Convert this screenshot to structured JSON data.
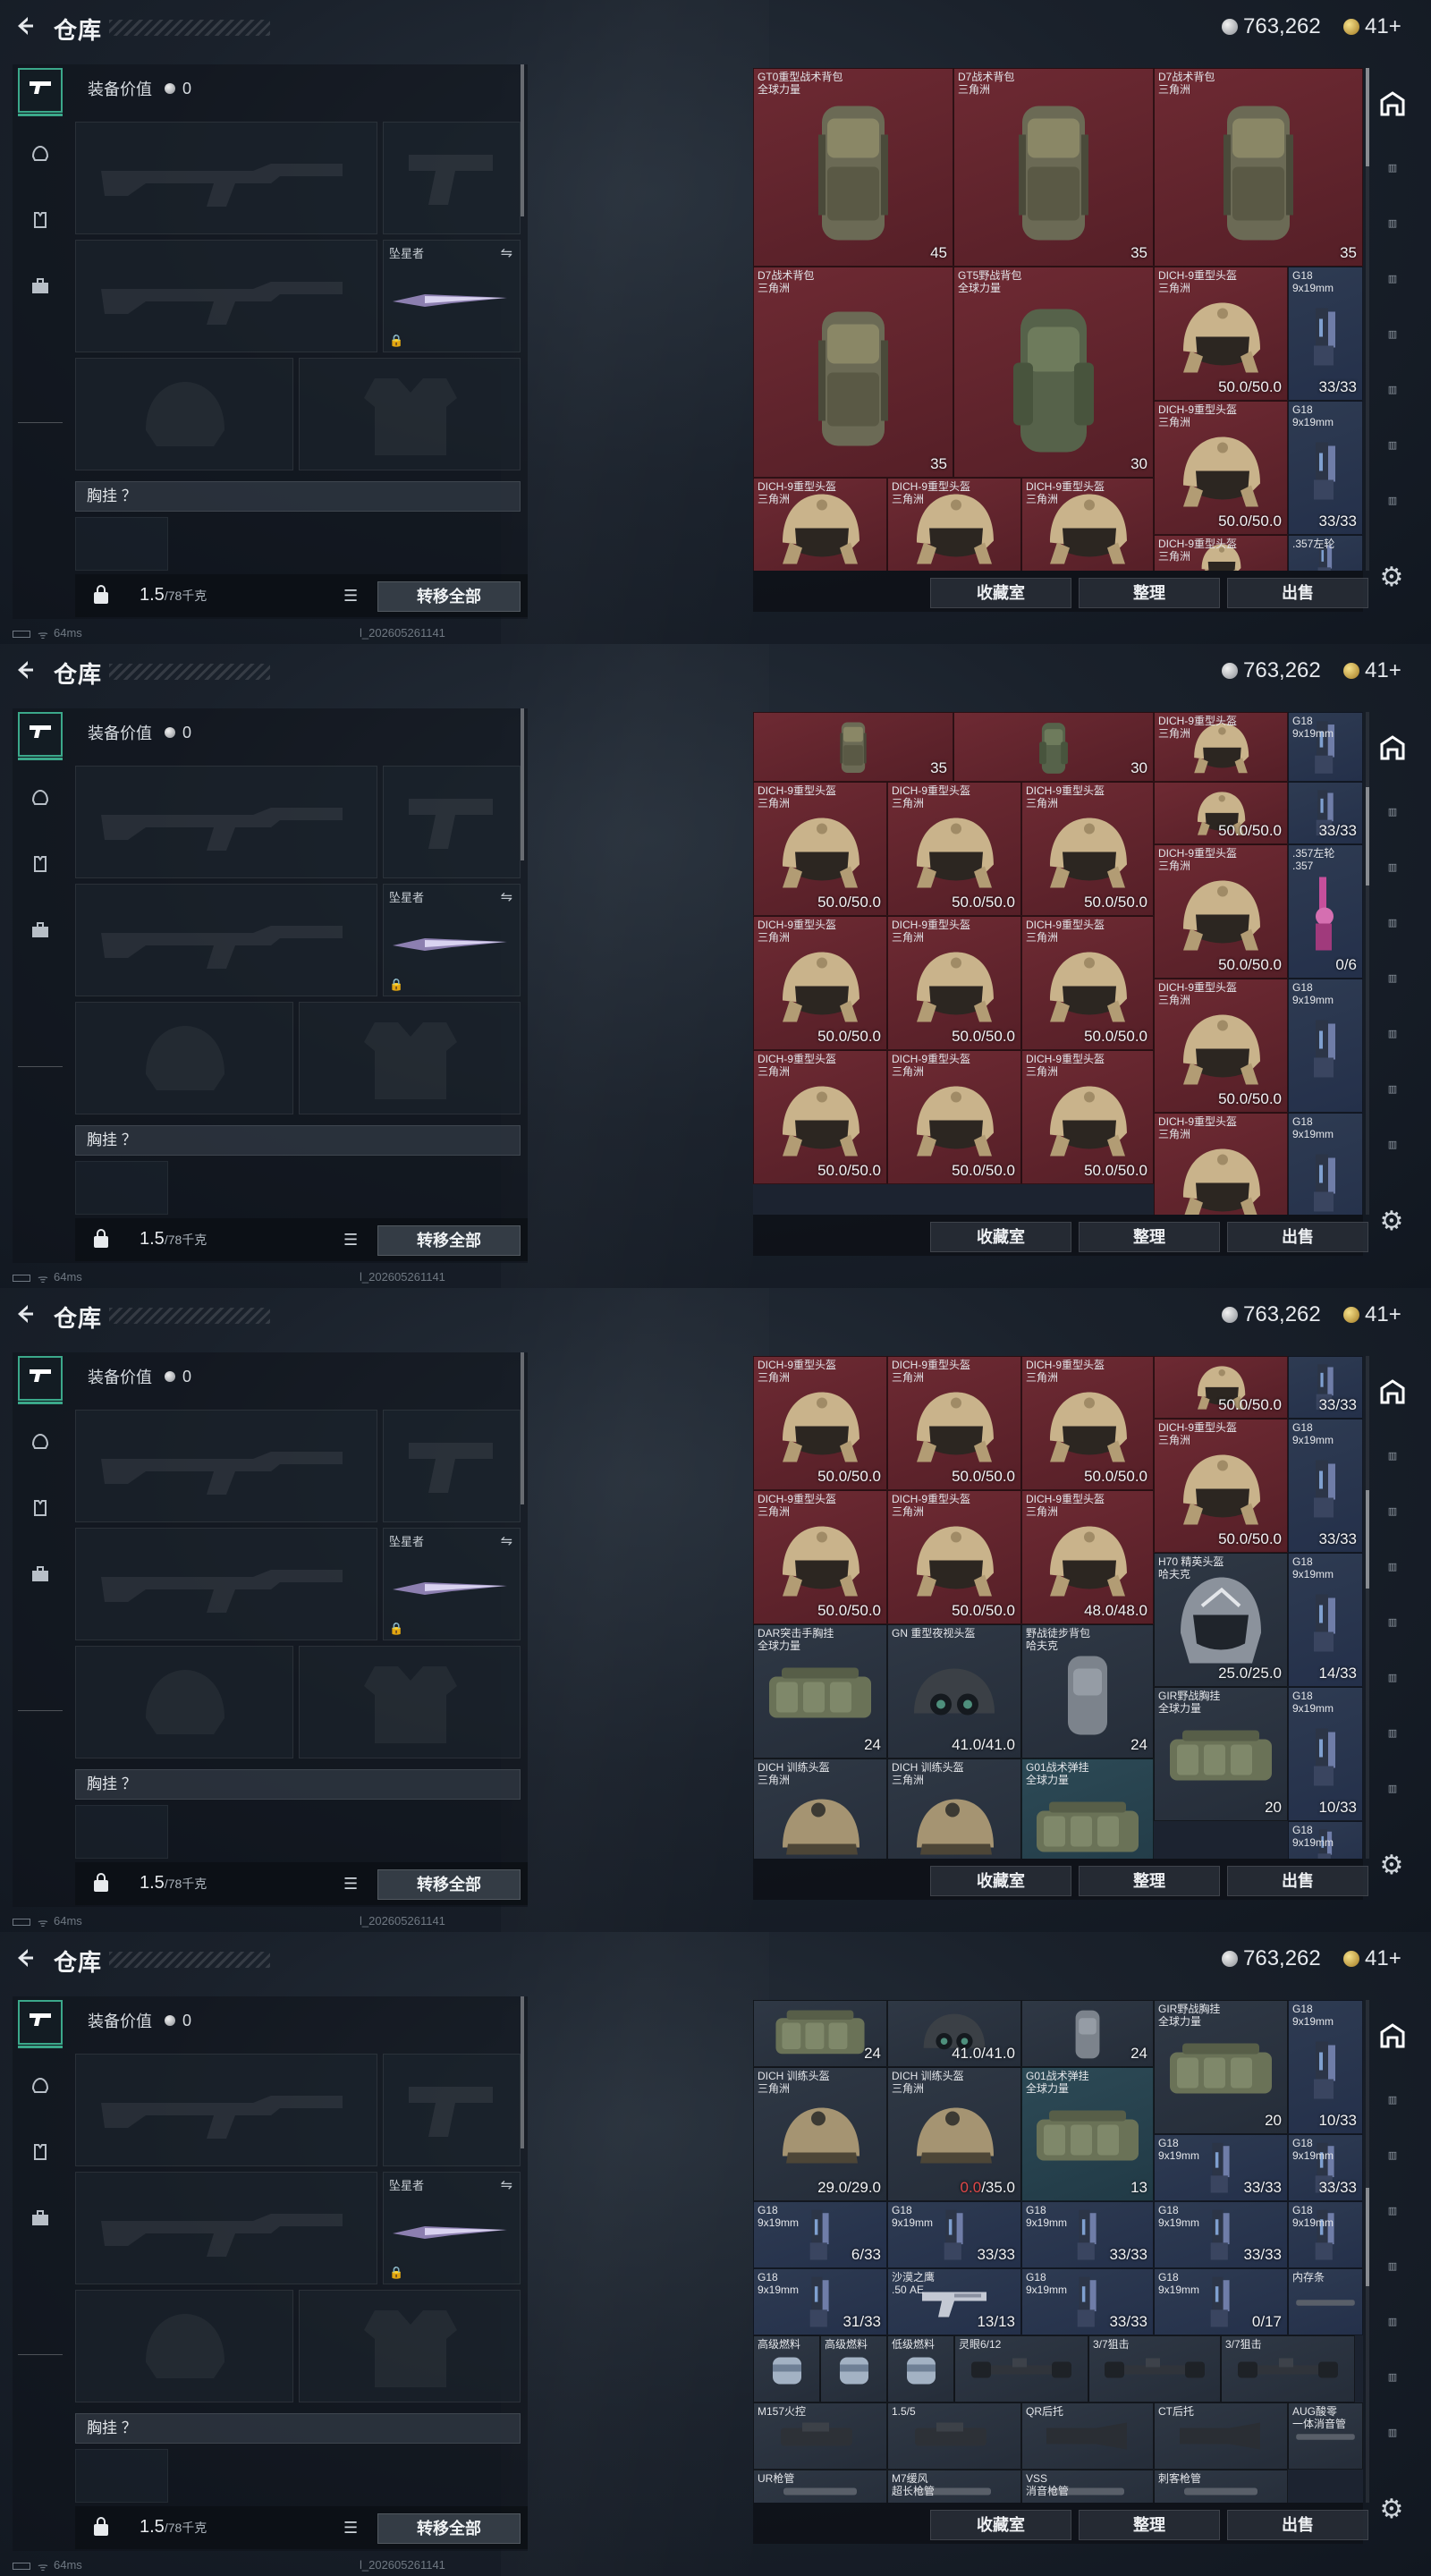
{
  "header": {
    "title": "仓库",
    "silver": "763,262",
    "gold": "41+"
  },
  "left": {
    "equip_value_label": "装备价值",
    "equip_value": "0",
    "melee_name": "坠星者",
    "chest_label": "胸挂 ？",
    "weight": "1.5",
    "weight_max": "/78千克",
    "transfer_all": "转移全部",
    "tabs": [
      "weapon-icon",
      "helmet-icon",
      "vest-icon",
      "briefcase-icon"
    ]
  },
  "footer_buttons": {
    "collection": "收藏室",
    "sort": "整理",
    "sell": "出售"
  },
  "status": {
    "ping": "64ms",
    "build": "l_202605261141"
  },
  "frames": [
    {
      "cells": [
        {
          "n": "GT0重型战术背包\n全球力量",
          "v": "45",
          "c": "red",
          "art": "bag"
        },
        {
          "n": "D7战术背包\n三角洲",
          "v": "35",
          "c": "red",
          "art": "bag"
        },
        {
          "n": "D7战术背包\n三角洲",
          "v": "35",
          "c": "red",
          "art": "bag"
        },
        {
          "n": "D7战术背包\n三角洲",
          "v": "35",
          "c": "red",
          "art": "bag"
        },
        {
          "n": "GT5野战背包\n全球力量",
          "v": "30",
          "c": "red",
          "art": "bag2"
        },
        {
          "n": "DICH-9重型头盔\n三角洲",
          "v": "50.0/50.0",
          "c": "red",
          "art": "helmet"
        },
        {
          "n": "G18\n9x19mm",
          "v": "33/33",
          "c": "blue",
          "art": "pistol"
        },
        {
          "n": "DICH-9重型头盔\n三角洲",
          "v": "50.0/50.0",
          "c": "red",
          "art": "helmet"
        },
        {
          "n": "G18\n9x19mm",
          "v": "33/33",
          "c": "blue",
          "art": "pistol"
        },
        {
          "n": "DICH-9重型头盔\n三角洲",
          "v": "",
          "c": "red",
          "art": "helmet"
        },
        {
          "n": "DICH-9重型头盔\n三角洲",
          "v": "",
          "c": "red",
          "art": "helmet"
        },
        {
          "n": "DICH-9重型头盔\n三角洲",
          "v": "",
          "c": "red",
          "art": "helmet"
        },
        {
          "n": "DICH-9重型头盔\n三角洲",
          "v": "",
          "c": "red",
          "art": "helmet"
        },
        {
          "n": ".357左轮",
          "v": "",
          "c": "blue",
          "art": "pistol"
        }
      ]
    },
    {
      "cells": [
        {
          "n": "",
          "v": "35",
          "c": "red",
          "art": "bag"
        },
        {
          "n": "",
          "v": "30",
          "c": "red",
          "art": "bag2"
        },
        {
          "n": "DICH-9重型头盔\n三角洲",
          "v": "",
          "c": "red",
          "art": "helmet"
        },
        {
          "n": "G18\n9x19mm",
          "v": "",
          "c": "blue",
          "art": "pistol"
        },
        {
          "n": "DICH-9重型头盔\n三角洲",
          "v": "50.0/50.0",
          "c": "red",
          "art": "helmet"
        },
        {
          "n": "DICH-9重型头盔\n三角洲",
          "v": "50.0/50.0",
          "c": "red",
          "art": "helmet"
        },
        {
          "n": "DICH-9重型头盔\n三角洲",
          "v": "50.0/50.0",
          "c": "red",
          "art": "helmet"
        },
        {
          "n": "",
          "v": "50.0/50.0",
          "c": "red",
          "art": "helmet"
        },
        {
          "n": "",
          "v": "33/33",
          "c": "blue",
          "art": "pistol"
        },
        {
          "n": ".357左轮\n.357",
          "v": "0/6",
          "c": "blue",
          "art": "revolver"
        },
        {
          "n": "DICH-9重型头盔\n三角洲",
          "v": "50.0/50.0",
          "c": "red",
          "art": "helmet"
        },
        {
          "n": "DICH-9重型头盔\n三角洲",
          "v": "50.0/50.0",
          "c": "red",
          "art": "helmet"
        },
        {
          "n": "DICH-9重型头盔\n三角洲",
          "v": "50.0/50.0",
          "c": "red",
          "art": "helmet"
        },
        {
          "n": "DICH-9重型头盔\n三角洲",
          "v": "50.0/50.0",
          "c": "red",
          "art": "helmet"
        },
        {
          "n": "G18\n9x19mm",
          "v": "",
          "c": "blue",
          "art": "pistol"
        },
        {
          "n": "DICH-9重型头盔\n三角洲",
          "v": "50.0/50.0",
          "c": "red",
          "art": "helmet"
        },
        {
          "n": "DICH-9重型头盔\n三角洲",
          "v": "50.0/50.0",
          "c": "red",
          "art": "helmet"
        },
        {
          "n": "DICH-9重型头盔\n三角洲",
          "v": "50.0/50.0",
          "c": "red",
          "art": "helmet"
        },
        {
          "n": "DICH-9重型头盔\n三角洲",
          "v": "50.0/50.0",
          "c": "red",
          "art": "helmet"
        },
        {
          "n": "G18\n9x19mm",
          "v": "33/33",
          "c": "blue",
          "art": "pistol"
        },
        {
          "n": "DICH-9重型头盔\n三角洲",
          "v": "",
          "c": "red",
          "art": "helmet"
        },
        {
          "n": "G18\n9x19mm",
          "v": "",
          "c": "blue",
          "art": "pistol"
        }
      ]
    },
    {
      "cells": [
        {
          "n": "DICH-9重型头盔\n三角洲",
          "v": "50.0/50.0",
          "c": "red",
          "art": "helmet"
        },
        {
          "n": "DICH-9重型头盔\n三角洲",
          "v": "50.0/50.0",
          "c": "red",
          "art": "helmet"
        },
        {
          "n": "DICH-9重型头盔\n三角洲",
          "v": "50.0/50.0",
          "c": "red",
          "art": "helmet"
        },
        {
          "n": "",
          "v": "50.0/50.0",
          "c": "red",
          "art": "helmet"
        },
        {
          "n": "",
          "v": "33/33",
          "c": "blue",
          "art": "pistol"
        },
        {
          "n": "DICH-9重型头盔\n三角洲",
          "v": "50.0/50.0",
          "c": "red",
          "art": "helmet"
        },
        {
          "n": "DICH-9重型头盔\n三角洲",
          "v": "50.0/50.0",
          "c": "red",
          "art": "helmet"
        },
        {
          "n": "DICH-9重型头盔\n三角洲",
          "v": "48.0/48.0",
          "c": "red",
          "art": "helmet"
        },
        {
          "n": "DICH-9重型头盔\n三角洲",
          "v": "50.0/50.0",
          "c": "red",
          "art": "helmet"
        },
        {
          "n": "G18\n9x19mm",
          "v": "33/33",
          "c": "blue",
          "art": "pistol"
        },
        {
          "n": "DAR突击手胸挂\n全球力量",
          "v": "24",
          "c": "grey",
          "art": "rig"
        },
        {
          "n": "GN 重型夜视头盔",
          "v": "41.0/41.0",
          "c": "grey",
          "art": "nvg"
        },
        {
          "n": "野战徒步背包\n哈夫克",
          "v": "24",
          "c": "grey",
          "art": "bag3"
        },
        {
          "n": "H70 精英头盔\n哈夫克",
          "v": "25.0/25.0",
          "c": "grey",
          "art": "mask"
        },
        {
          "n": "G18\n9x19mm",
          "v": "14/33",
          "c": "blue",
          "art": "pistol"
        },
        {
          "n": "GIR野战胸挂\n全球力量",
          "v": "20",
          "c": "grey",
          "art": "rig"
        },
        {
          "n": "G18\n9x19mm",
          "v": "10/33",
          "c": "blue",
          "art": "pistol"
        },
        {
          "n": "DICH 训练头盔\n三角洲",
          "v": "",
          "c": "grey",
          "art": "helmet2"
        },
        {
          "n": "DICH 训练头盔\n三角洲",
          "v": "",
          "c": "grey",
          "art": "helmet2"
        },
        {
          "n": "G01战术弹挂\n全球力量",
          "v": "",
          "c": "teal",
          "art": "rig"
        },
        {
          "n": "G18\n9x19mm",
          "v": "",
          "c": "blue",
          "art": "pistol"
        }
      ]
    },
    {
      "cells": [
        {
          "n": "",
          "v": "24",
          "c": "grey",
          "art": "rig"
        },
        {
          "n": "",
          "v": "41.0/41.0",
          "c": "grey",
          "art": "nvg"
        },
        {
          "n": "",
          "v": "24",
          "c": "grey",
          "art": "bag3"
        },
        {
          "n": "GIR野战胸挂\n全球力量",
          "v": "20",
          "c": "grey",
          "art": "rig"
        },
        {
          "n": "G18\n9x19mm",
          "v": "10/33",
          "c": "blue",
          "art": "pistol"
        },
        {
          "n": "DICH 训练头盔\n三角洲",
          "v": "29.0/29.0",
          "c": "grey",
          "art": "helmet2"
        },
        {
          "n": "DICH 训练头盔\n三角洲",
          "v": "0.0/35.0",
          "c": "grey",
          "art": "helmet2",
          "warnpart": "0.0"
        },
        {
          "n": "G01战术弹挂\n全球力量",
          "v": "13",
          "c": "teal",
          "art": "rig"
        },
        {
          "n": "G18\n9x19mm",
          "v": "33/33",
          "c": "blue",
          "art": "pistol"
        },
        {
          "n": "G18\n9x19mm",
          "v": "33/33",
          "c": "blue",
          "art": "pistol"
        },
        {
          "n": "G18\n9x19mm",
          "v": "6/33",
          "c": "blue",
          "art": "pistol"
        },
        {
          "n": "G18\n9x19mm",
          "v": "33/33",
          "c": "blue",
          "art": "pistol"
        },
        {
          "n": "G18\n9x19mm",
          "v": "33/33",
          "c": "blue",
          "art": "pistol"
        },
        {
          "n": "G18\n9x19mm",
          "v": "33/33",
          "c": "blue",
          "art": "pistol"
        },
        {
          "n": "G18\n9x19mm",
          "v": "",
          "c": "blue",
          "art": "pistol"
        },
        {
          "n": "G18\n9x19mm",
          "v": "31/33",
          "c": "blue",
          "art": "pistol"
        },
        {
          "n": "沙漠之鹰\n.50 AE",
          "v": "13/13",
          "c": "blue",
          "art": "pistol2"
        },
        {
          "n": "G18\n9x19mm",
          "v": "33/33",
          "c": "blue",
          "art": "pistol"
        },
        {
          "n": "G18\n9x19mm",
          "v": "0/17",
          "c": "blue",
          "art": "pistol"
        },
        {
          "n": "内存条",
          "v": "",
          "c": "blue",
          "art": "stick"
        },
        {
          "n": "高级燃料",
          "v": "",
          "c": "grey",
          "art": "can"
        },
        {
          "n": "高级燃料",
          "v": "",
          "c": "grey",
          "art": "can"
        },
        {
          "n": "低级燃料",
          "v": "",
          "c": "grey",
          "art": "can"
        },
        {
          "n": "灵眼6/12",
          "v": "",
          "c": "grey",
          "art": "scope"
        },
        {
          "n": "3/7狙击",
          "v": "",
          "c": "grey",
          "art": "scope"
        },
        {
          "n": "3/7狙击",
          "v": "",
          "c": "grey",
          "art": "scope"
        },
        {
          "n": "M157火控",
          "v": "",
          "c": "grey",
          "art": "scope2"
        },
        {
          "n": "1.5/5",
          "v": "",
          "c": "grey",
          "art": "scope2"
        },
        {
          "n": "QR后托",
          "v": "",
          "c": "grey",
          "art": "stock"
        },
        {
          "n": "CT后托",
          "v": "",
          "c": "grey",
          "art": "stock"
        },
        {
          "n": "AUG酸零\n一体消音管",
          "v": "",
          "c": "grey",
          "art": "stick"
        },
        {
          "n": "UR枪管",
          "v": "",
          "c": "grey",
          "art": "stick"
        },
        {
          "n": "M7缓风\n超长枪管",
          "v": "",
          "c": "grey",
          "art": "stick"
        },
        {
          "n": "VSS\n消音枪管",
          "v": "",
          "c": "grey",
          "art": "stick"
        },
        {
          "n": "刺客枪管",
          "v": "",
          "c": "grey",
          "art": "stick"
        }
      ]
    }
  ]
}
